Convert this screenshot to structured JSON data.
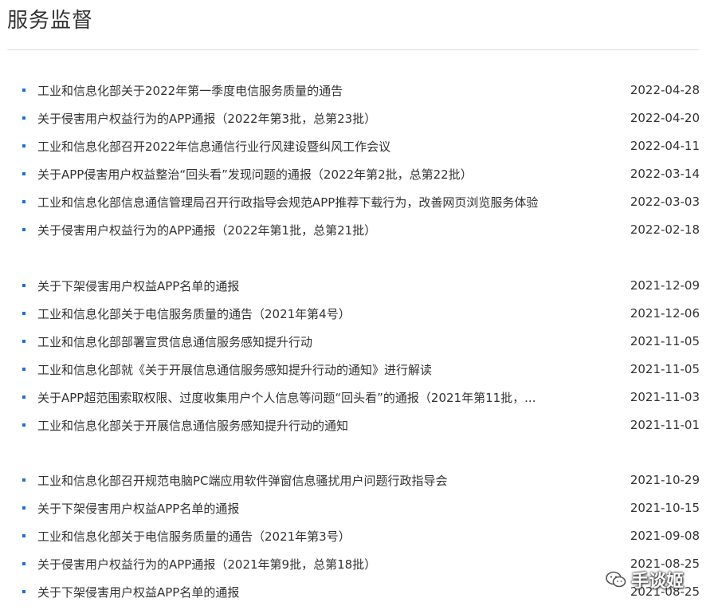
{
  "page": {
    "title": "服务监督"
  },
  "accent_color": "#1e6fd1",
  "groups": [
    {
      "items": [
        {
          "title": "工业和信息化部关于2022年第一季度电信服务质量的通告",
          "date": "2022-04-28"
        },
        {
          "title": "关于侵害用户权益行为的APP通报（2022年第3批，总第23批）",
          "date": "2022-04-20"
        },
        {
          "title": "工业和信息化部召开2022年信息通信行业行风建设暨纠风工作会议",
          "date": "2022-04-11"
        },
        {
          "title": "关于APP侵害用户权益整治“回头看”发现问题的通报（2022年第2批，总第22批）",
          "date": "2022-03-14"
        },
        {
          "title": "工业和信息化部信息通信管理局召开行政指导会规范APP推荐下载行为，改善网页浏览服务体验",
          "date": "2022-03-03"
        },
        {
          "title": "关于侵害用户权益行为的APP通报（2022年第1批，总第21批）",
          "date": "2022-02-18"
        }
      ]
    },
    {
      "items": [
        {
          "title": "关于下架侵害用户权益APP名单的通报",
          "date": "2021-12-09"
        },
        {
          "title": "工业和信息化部关于电信服务质量的通告（2021年第4号）",
          "date": "2021-12-06"
        },
        {
          "title": "工业和信息化部部署宣贯信息通信服务感知提升行动",
          "date": "2021-11-05"
        },
        {
          "title": "工业和信息化部就《关于开展信息通信服务感知提升行动的通知》进行解读",
          "date": "2021-11-05"
        },
        {
          "title": "关于APP超范围索取权限、过度收集用户个人信息等问题“回头看”的通报（2021年第11批，...",
          "date": "2021-11-03"
        },
        {
          "title": "工业和信息化部关于开展信息通信服务感知提升行动的通知",
          "date": "2021-11-01"
        }
      ]
    },
    {
      "items": [
        {
          "title": "工业和信息化部召开规范电脑PC端应用软件弹窗信息骚扰用户问题行政指导会",
          "date": "2021-10-29"
        },
        {
          "title": "关于下架侵害用户权益APP名单的通报",
          "date": "2021-10-15"
        },
        {
          "title": "工业和信息化部关于电信服务质量的通告（2021年第3号）",
          "date": "2021-09-08"
        },
        {
          "title": "关于侵害用户权益行为的APP通报（2021年第9批，总第18批）",
          "date": "2021-08-25"
        },
        {
          "title": "关于下架侵害用户权益APP名单的通报",
          "date": "2021-08-25"
        }
      ]
    }
  ],
  "watermark": {
    "text": "手谈姬",
    "icon": "wechat-icon"
  }
}
